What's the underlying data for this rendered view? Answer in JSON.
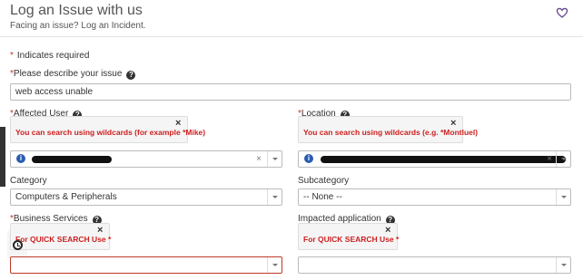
{
  "header": {
    "title": "Log an Issue with us",
    "subtitle": "Facing an issue? Log an Incident."
  },
  "required_note": "Indicates required",
  "required_star": "*",
  "fields": {
    "describe": {
      "label": "Please describe your issue",
      "value": "web access unable"
    },
    "affected_user": {
      "label": "Affected User",
      "hint": "You can search using wildcards (for example *Mike)",
      "info": "i",
      "clear": "×"
    },
    "location": {
      "label": "Location",
      "hint": "You can search using wildcards (e.g. *Montluel)",
      "info": "i",
      "clear": "×"
    },
    "category": {
      "label": "Category",
      "value": "Computers & Peripherals"
    },
    "subcategory": {
      "label": "Subcategory",
      "value": "-- None --"
    },
    "business_services": {
      "label": "Business Services",
      "hint": "For QUICK SEARCH Use *",
      "value": ""
    },
    "impacted_application": {
      "label": "Impacted application",
      "hint": "For QUICK SEARCH Use *",
      "value": ""
    }
  },
  "icons": {
    "help": "?",
    "close": "×"
  },
  "colors": {
    "required": "#c0392b",
    "hint_text": "#cc1f1f",
    "info": "#2a5db0"
  }
}
